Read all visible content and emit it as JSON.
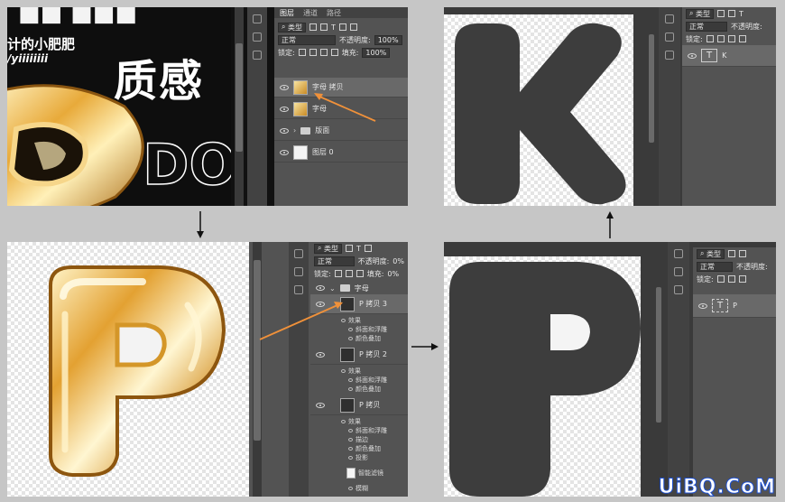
{
  "panel_tabs": [
    "图层",
    "通道",
    "路径"
  ],
  "filter_kind": "类型",
  "blend_mode": "正常",
  "opacity_label": "不透明度:",
  "opacity_value": "100%",
  "opacity_value_cropped": "0%",
  "lock_label": "锁定:",
  "fill_label": "填充:",
  "fill_value": "100%",
  "fill_value_cropped": "0%",
  "screen1": {
    "poster_line1": "计的小肥肥",
    "poster_line2": "/yiiiiiiii",
    "poster_big": "质感",
    "layers": [
      {
        "name": "字母 拷贝",
        "thumb": "gold",
        "selected": true
      },
      {
        "name": "字母",
        "thumb": "gold",
        "selected": false
      },
      {
        "name": "版面",
        "thumb": "folder",
        "selected": false
      },
      {
        "name": "图层 0",
        "thumb": "white",
        "selected": false
      }
    ]
  },
  "screen2": {
    "group_name": "字母",
    "layers": [
      {
        "name": "P 拷贝 3",
        "effects_header": "效果",
        "effects": [
          "斜面和浮雕",
          "颜色叠加"
        ]
      },
      {
        "name": "P 拷贝 2",
        "effects_header": "效果",
        "effects": [
          "斜面和浮雕",
          "颜色叠加"
        ]
      },
      {
        "name": "P 拷贝",
        "effects_header": "效果",
        "effects": [
          "斜面和浮雕",
          "描边",
          "颜色叠加",
          "投影"
        ]
      }
    ],
    "smart_filter": "智能滤镜",
    "blur_filter": "模糊"
  },
  "screen3": {
    "letter": "P",
    "layer_name": "P",
    "layer_type_glyph": "T"
  },
  "screen4": {
    "letter": "K",
    "layer_name": "K",
    "layer_type_glyph": "T"
  },
  "watermark": {
    "part1": "UiBQ",
    "part2": ".CoM"
  },
  "colors": {
    "ps_panel": "#535353",
    "ps_dark": "#424242",
    "letter_fill": "#3d3d3d",
    "arrow_orange": "#f0913a",
    "gold": "#d99a2b",
    "page_bg": "#c6c6c6"
  }
}
